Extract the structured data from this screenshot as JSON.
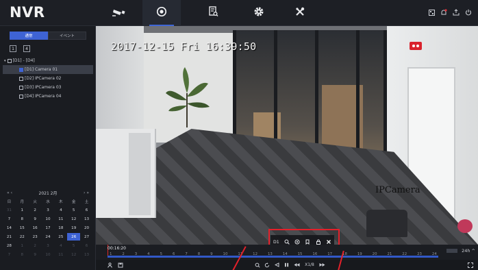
{
  "app": {
    "brand": "NVR"
  },
  "nav": {
    "tabs": [
      {
        "id": "live-view",
        "icon": "camera-icon",
        "active": false
      },
      {
        "id": "playback",
        "icon": "playback-icon",
        "active": true
      },
      {
        "id": "search",
        "icon": "file-search-icon",
        "active": false
      },
      {
        "id": "settings",
        "icon": "gear-icon",
        "active": false
      },
      {
        "id": "maintenance",
        "icon": "tools-icon",
        "active": false
      }
    ],
    "right_icons": [
      "qr-icon",
      "notification-icon",
      "export-icon",
      "power-icon"
    ]
  },
  "left_panel": {
    "mode_tabs": [
      {
        "label": "通常",
        "active": true
      },
      {
        "label": "イベント",
        "active": false
      }
    ],
    "grid_buttons": [
      "1",
      "4"
    ],
    "tree": {
      "group": "[D1] - [D4]",
      "cameras": [
        {
          "label": "[D1] Camera 01",
          "selected": true
        },
        {
          "label": "[D2] IPCamera 02",
          "selected": false
        },
        {
          "label": "[D3] IPCamera 03",
          "selected": false
        },
        {
          "label": "[D4] IPCamera 04",
          "selected": false
        }
      ]
    },
    "calendar": {
      "prev_label": "« ‹",
      "next_label": "› »",
      "month_label": "2021 2月",
      "weekdays": [
        "日",
        "月",
        "火",
        "水",
        "木",
        "金",
        "土"
      ],
      "days": [
        {
          "d": "31",
          "dim": true
        },
        {
          "d": "1"
        },
        {
          "d": "2"
        },
        {
          "d": "3"
        },
        {
          "d": "4"
        },
        {
          "d": "5"
        },
        {
          "d": "6"
        },
        {
          "d": "7"
        },
        {
          "d": "8"
        },
        {
          "d": "9"
        },
        {
          "d": "10"
        },
        {
          "d": "11"
        },
        {
          "d": "12"
        },
        {
          "d": "13"
        },
        {
          "d": "14"
        },
        {
          "d": "15"
        },
        {
          "d": "16"
        },
        {
          "d": "17"
        },
        {
          "d": "18"
        },
        {
          "d": "19"
        },
        {
          "d": "20"
        },
        {
          "d": "21"
        },
        {
          "d": "22"
        },
        {
          "d": "23"
        },
        {
          "d": "24"
        },
        {
          "d": "25"
        },
        {
          "d": "26",
          "sel": true
        },
        {
          "d": "27"
        },
        {
          "d": "28"
        },
        {
          "d": "1",
          "dim": true
        },
        {
          "d": "2",
          "dim": true
        },
        {
          "d": "3",
          "dim": true
        },
        {
          "d": "4",
          "dim": true
        },
        {
          "d": "5",
          "dim": true
        },
        {
          "d": "6",
          "dim": true
        },
        {
          "d": "7",
          "dim": true
        },
        {
          "d": "8",
          "dim": true
        },
        {
          "d": "9",
          "dim": true
        },
        {
          "d": "10",
          "dim": true
        },
        {
          "d": "11",
          "dim": true
        },
        {
          "d": "12",
          "dim": true
        },
        {
          "d": "13",
          "dim": true
        }
      ]
    }
  },
  "video": {
    "timestamp": "2017-12-15 Fri 16:39:50",
    "camera_name": "IPCamera",
    "overlay": {
      "channel_label": "D1",
      "tool_icons": [
        "zoom-icon",
        "snapshot-icon",
        "bookmark-icon",
        "lock-icon",
        "close-icon"
      ]
    }
  },
  "timeline": {
    "cursor_label": "00:16:20",
    "hours": [
      "1",
      "2",
      "3",
      "4",
      "5",
      "6",
      "7",
      "8",
      "9",
      "10",
      "11",
      "12",
      "13",
      "14",
      "15",
      "16",
      "17",
      "18",
      "19",
      "20",
      "21",
      "22",
      "23",
      "24"
    ],
    "zoom_label": "24h ^"
  },
  "controls": {
    "speed_label": "X1/8",
    "left_icons": [
      "user-icon",
      "save-icon"
    ],
    "center_icons": [
      "search-clip-icon",
      "rewind-30-icon",
      "reverse-icon",
      "pause-icon",
      "slow-icon"
    ],
    "right_icons": [
      "fullscreen-icon"
    ]
  },
  "colors": {
    "accent": "#3e63d4",
    "highlight": "#e3202a",
    "recording": "#d9232d"
  }
}
